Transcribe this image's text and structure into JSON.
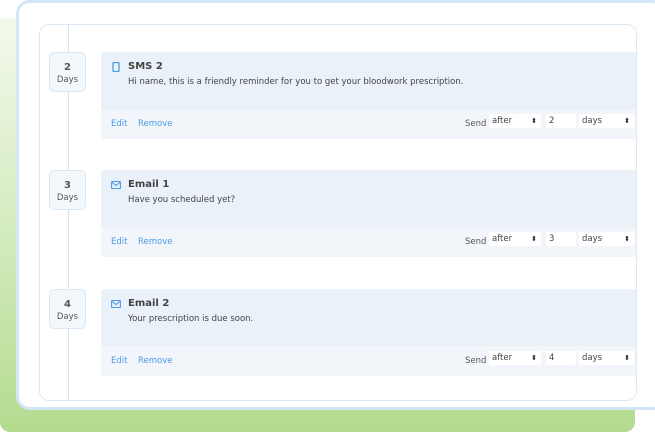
{
  "colors": {
    "accent": "#4a9be8",
    "green": "#b3dc8f"
  },
  "steps": [
    {
      "days": "2",
      "unit": "Days",
      "icon": "phone-icon",
      "title": "SMS 2",
      "message": "Hi name, this is a friendly reminder for you to get your bloodwork prescription.",
      "edit": "Edit",
      "remove": "Remove",
      "send_label": "Send",
      "timing": "after",
      "amount": "2",
      "period": "days"
    },
    {
      "days": "3",
      "unit": "Days",
      "icon": "envelope-icon",
      "title": "Email 1",
      "message": "Have you scheduled yet?",
      "edit": "Edit",
      "remove": "Remove",
      "send_label": "Send",
      "timing": "after",
      "amount": "3",
      "period": "days"
    },
    {
      "days": "4",
      "unit": "Days",
      "icon": "envelope-icon",
      "title": "Email 2",
      "message": "Your prescription is due soon.",
      "edit": "Edit",
      "remove": "Remove",
      "send_label": "Send",
      "timing": "after",
      "amount": "4",
      "period": "days"
    }
  ]
}
